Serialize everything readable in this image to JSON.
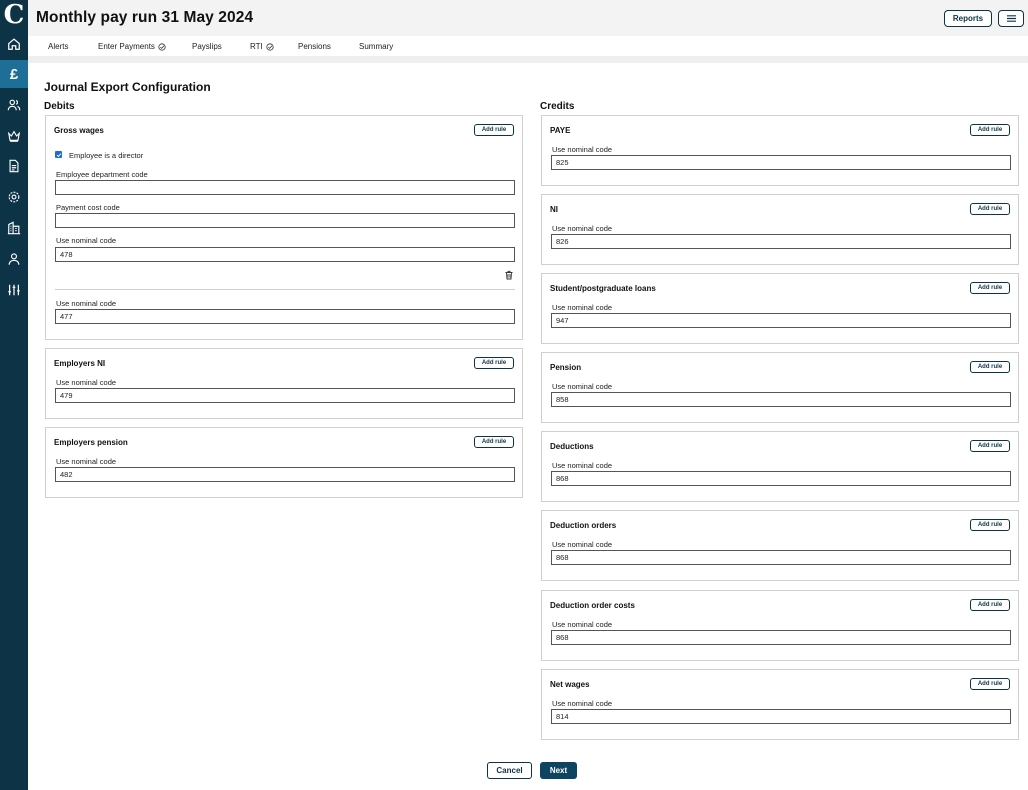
{
  "app": {
    "logo_letter": "C"
  },
  "sidebar": {
    "items": [
      {
        "name": "home-icon"
      },
      {
        "name": "pound-icon",
        "glyph": "£",
        "active": true
      },
      {
        "name": "users-icon"
      },
      {
        "name": "crown-icon"
      },
      {
        "name": "document-icon"
      },
      {
        "name": "gear-icon"
      },
      {
        "name": "building-icon"
      },
      {
        "name": "person-icon"
      },
      {
        "name": "sliders-icon"
      }
    ]
  },
  "header": {
    "title": "Monthly pay run 31 May 2024",
    "reports_label": "Reports"
  },
  "tabs": [
    {
      "label": "Alerts",
      "check": false
    },
    {
      "label": "Enter Payments",
      "check": true
    },
    {
      "label": "Payslips",
      "check": false
    },
    {
      "label": "RTI",
      "check": true
    },
    {
      "label": "Pensions",
      "check": false
    },
    {
      "label": "Summary",
      "check": false
    }
  ],
  "page": {
    "heading": "Journal Export Configuration",
    "debits_heading": "Debits",
    "credits_heading": "Credits"
  },
  "debits": {
    "gross_wages": {
      "title": "Gross wages",
      "add_rule": "Add rule",
      "checkbox_label": "Employee is a director",
      "dept_label": "Employee department code",
      "dept_value": "",
      "cost_label": "Payment cost code",
      "cost_value": "",
      "rule_nominal_label": "Use nominal code",
      "rule_nominal_value": "478",
      "default_nominal_label": "Use nominal code",
      "default_nominal_value": "477"
    },
    "employers_ni": {
      "title": "Employers NI",
      "add_rule": "Add rule",
      "nominal_label": "Use nominal code",
      "nominal_value": "479"
    },
    "employers_pension": {
      "title": "Employers pension",
      "add_rule": "Add rule",
      "nominal_label": "Use nominal code",
      "nominal_value": "482"
    }
  },
  "credits": [
    {
      "title": "PAYE",
      "add_rule": "Add rule",
      "nominal_label": "Use nominal code",
      "nominal_value": "825"
    },
    {
      "title": "NI",
      "add_rule": "Add rule",
      "nominal_label": "Use nominal code",
      "nominal_value": "826"
    },
    {
      "title": "Student/postgraduate loans",
      "add_rule": "Add rule",
      "nominal_label": "Use nominal code",
      "nominal_value": "947"
    },
    {
      "title": "Pension",
      "add_rule": "Add rule",
      "nominal_label": "Use nominal code",
      "nominal_value": "858"
    },
    {
      "title": "Deductions",
      "add_rule": "Add rule",
      "nominal_label": "Use nominal code",
      "nominal_value": "868"
    },
    {
      "title": "Deduction orders",
      "add_rule": "Add rule",
      "nominal_label": "Use nominal code",
      "nominal_value": "868"
    },
    {
      "title": "Deduction order costs",
      "add_rule": "Add rule",
      "nominal_label": "Use nominal code",
      "nominal_value": "868"
    },
    {
      "title": "Net wages",
      "add_rule": "Add rule",
      "nominal_label": "Use nominal code",
      "nominal_value": "814"
    }
  ],
  "footer": {
    "cancel_label": "Cancel",
    "next_label": "Next"
  },
  "colors": {
    "sidebar": "#0d3347",
    "accent": "#1d6f97",
    "primary_button": "#0d4460"
  }
}
